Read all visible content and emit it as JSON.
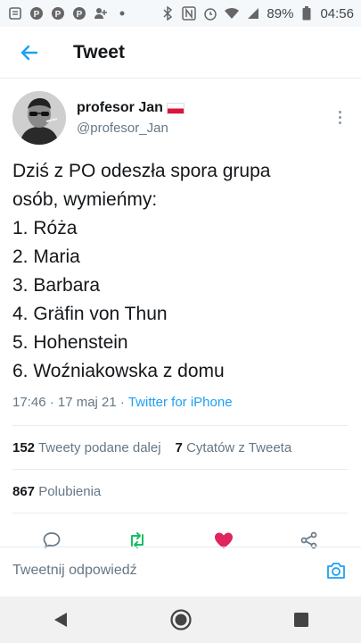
{
  "status_bar": {
    "battery": "89%",
    "time": "04:56"
  },
  "header": {
    "title": "Tweet"
  },
  "tweet": {
    "author_name": "profesor Jan",
    "author_handle": "@profesor_Jan",
    "lines": [
      "Dziś z PO odeszła spora grupa",
      "osób, wymieńmy:",
      "1. Róża",
      "2. Maria",
      "3. Barbara",
      "4. Gräfin von Thun",
      "5. Hohenstein",
      "6. Woźniakowska z domu"
    ],
    "timestamp": "17:46 · 17 maj 21 · ",
    "source": "Twitter for iPhone"
  },
  "stats": {
    "retweets_count": "152",
    "retweets_label": "Tweety podane dalej",
    "quotes_count": "7",
    "quotes_label": "Cytatów z Tweeta",
    "likes_count": "867",
    "likes_label": "Polubienia"
  },
  "reply": {
    "placeholder": "Tweetnij odpowiedź"
  },
  "colors": {
    "accent": "#1da1f2",
    "retweet": "#17bf63",
    "like": "#e0245e",
    "muted": "#657786"
  },
  "icons": {
    "back": "arrow-left-icon",
    "more": "more-vertical-icon",
    "reply": "comment-icon",
    "retweet": "retweet-icon",
    "like": "heart-icon",
    "share": "share-icon",
    "camera": "camera-icon"
  }
}
